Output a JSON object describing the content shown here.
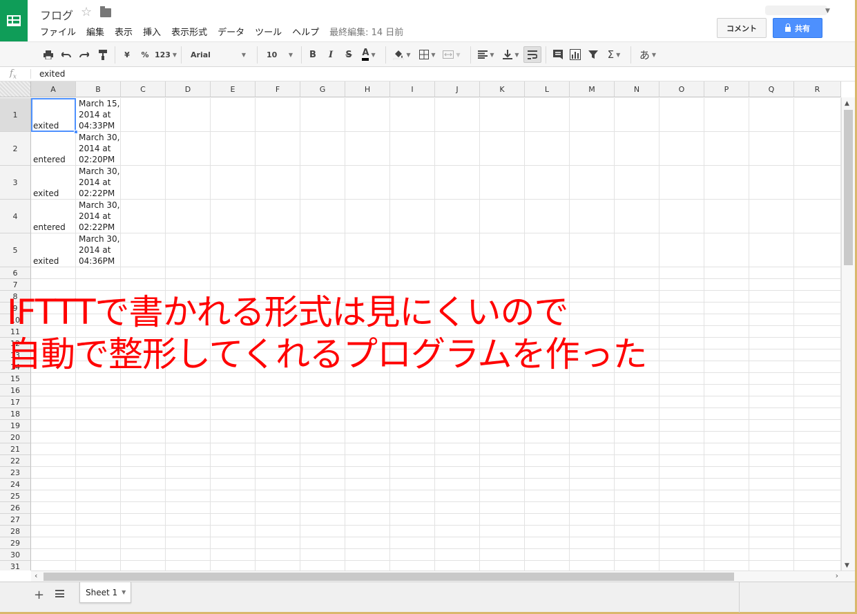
{
  "header": {
    "doc_title": "フログ",
    "menu": [
      "ファイル",
      "編集",
      "表示",
      "挿入",
      "表示形式",
      "データ",
      "ツール",
      "ヘルプ"
    ],
    "last_edit": "最終編集: 14 日前",
    "comment_label": "コメント",
    "share_label": "共有"
  },
  "toolbar": {
    "currency": "¥",
    "percent": "%",
    "number_format": "123",
    "font": "Arial",
    "font_size": "10",
    "bold": "B",
    "italic": "I",
    "strike": "S",
    "text_color": "A",
    "sigma": "Σ",
    "input_tool": "あ"
  },
  "formula_bar": {
    "fx": "fx",
    "value": "exited"
  },
  "columns": [
    "A",
    "B",
    "C",
    "D",
    "E",
    "F",
    "G",
    "H",
    "I",
    "J",
    "K",
    "L",
    "M",
    "N",
    "O",
    "P",
    "Q",
    "R"
  ],
  "rows": [
    {
      "num": "1",
      "a": "exited",
      "b": [
        "March 15,",
        "2014 at",
        "04:33PM"
      ]
    },
    {
      "num": "2",
      "a": "entered",
      "b": [
        "March 30,",
        "2014 at",
        "02:20PM"
      ]
    },
    {
      "num": "3",
      "a": "exited",
      "b": [
        "March 30,",
        "2014 at",
        "02:22PM"
      ]
    },
    {
      "num": "4",
      "a": "entered",
      "b": [
        "March 30,",
        "2014 at",
        "02:22PM"
      ]
    },
    {
      "num": "5",
      "a": "exited",
      "b": [
        "March 30,",
        "2014 at",
        "04:36PM"
      ]
    }
  ],
  "empty_row_numbers": [
    "6",
    "7",
    "8",
    "9",
    "10",
    "11",
    "12",
    "13",
    "14",
    "15",
    "16",
    "17",
    "18",
    "19",
    "20",
    "21",
    "22",
    "23",
    "24",
    "25",
    "26",
    "27",
    "28",
    "29",
    "30",
    "31"
  ],
  "sheet_tab": "Sheet 1",
  "overlay": {
    "line1": "IFTTTで書かれる形式は見にくいので",
    "line2": "自動で整形してくれるプログラムを作った",
    "color": "#ff0000"
  },
  "colors": {
    "brand": "#0f9d58",
    "share": "#4d90fe",
    "selection": "#4d90fe"
  }
}
